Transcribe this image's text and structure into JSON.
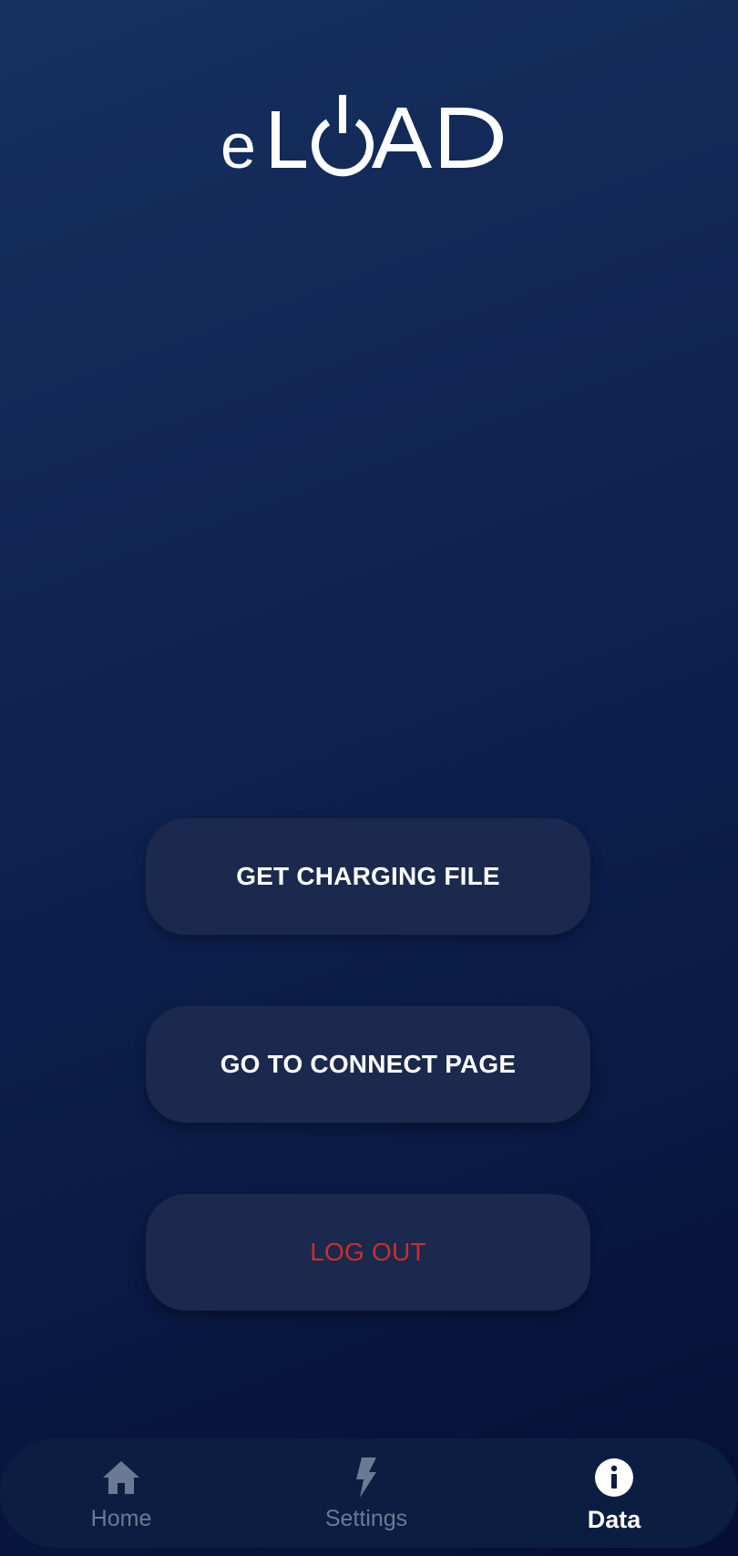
{
  "app": {
    "logo_text": "eLOAD"
  },
  "actions": {
    "get_charging_file": "GET CHARGING FILE",
    "go_to_connect_page": "GO TO CONNECT PAGE",
    "log_out": "LOG OUT"
  },
  "bottom_nav": {
    "items": [
      {
        "label": "Home",
        "icon": "home-icon",
        "active": false
      },
      {
        "label": "Settings",
        "icon": "lightning-bolt-icon",
        "active": false
      },
      {
        "label": "Data",
        "icon": "info-icon",
        "active": true
      }
    ]
  },
  "colors": {
    "background_top": "#17305f",
    "background_bottom": "#050f33",
    "button_bg": "#1a294d",
    "logout_text": "#c8302c",
    "nav_inactive": "#6b7a94",
    "nav_active": "#ffffff"
  }
}
